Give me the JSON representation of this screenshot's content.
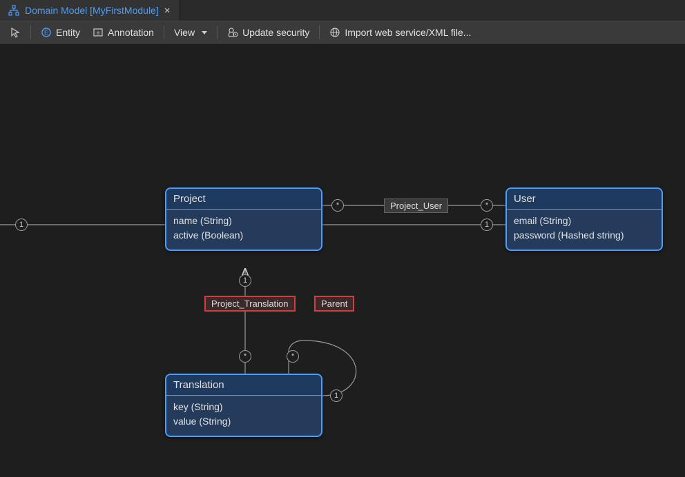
{
  "tab": {
    "title": "Domain Model [MyFirstModule]"
  },
  "toolbar": {
    "entity": "Entity",
    "annotation": "Annotation",
    "view": "View",
    "update_security": "Update security",
    "import": "Import web service/XML file..."
  },
  "entities": {
    "project": {
      "name": "Project",
      "attrs": [
        "name (String)",
        "active (Boolean)"
      ]
    },
    "user": {
      "name": "User",
      "attrs": [
        "email (String)",
        "password (Hashed string)"
      ]
    },
    "translation": {
      "name": "Translation",
      "attrs": [
        "key (String)",
        "value (String)"
      ]
    }
  },
  "associations": {
    "project_user": "Project_User",
    "project_translation": "Project_Translation",
    "parent": "Parent"
  },
  "multiplicities": {
    "one": "1",
    "many": "*"
  }
}
